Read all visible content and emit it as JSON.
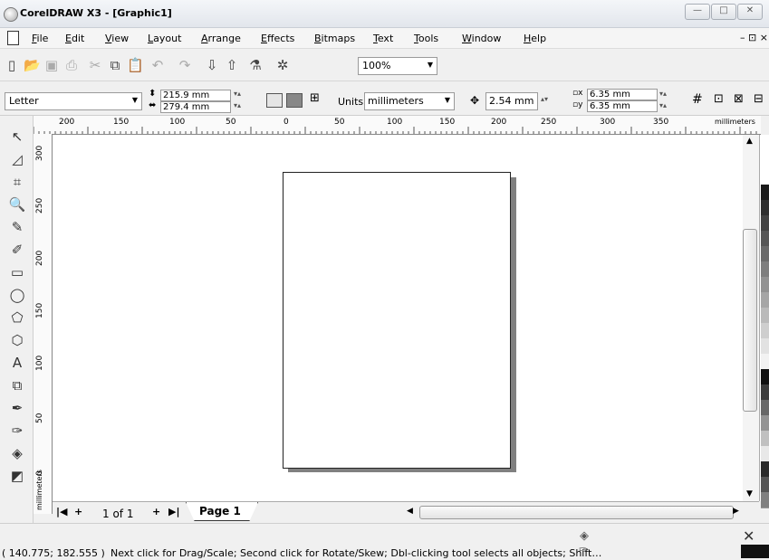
{
  "window": {
    "title": "CorelDRAW X3 - [Graphic1]",
    "min": "—",
    "max": "□",
    "close": "✕"
  },
  "menu": {
    "items": [
      "File",
      "Edit",
      "View",
      "Layout",
      "Arrange",
      "Effects",
      "Bitmaps",
      "Text",
      "Tools",
      "Window",
      "Help"
    ],
    "right_controls": "– ⊡ ×"
  },
  "standard_toolbar": {
    "zoom": "100%"
  },
  "property_bar": {
    "paper": "Letter",
    "width": "215.9 mm",
    "height": "279.4 mm",
    "units_label": "Units:",
    "units": "millimeters",
    "nudge": "2.54 mm",
    "dup_x": "6.35 mm",
    "dup_y": "6.35 mm"
  },
  "ruler": {
    "h_labels": [
      "200",
      "150",
      "100",
      "50",
      "0",
      "50",
      "100",
      "150",
      "200",
      "250",
      "300",
      "350"
    ],
    "h_units": "millimeters",
    "v_labels": [
      "300",
      "250",
      "200",
      "150",
      "100",
      "50",
      "0"
    ],
    "v_units": "millimeters"
  },
  "page_nav": {
    "count": "1 of 1",
    "tab": "Page 1"
  },
  "status": {
    "coords": "( 140.775; 182.555 )",
    "message": "Next click for Drag/Scale; Second click for Rotate/Skew; Dbl-clicking tool selects all objects; Shift…"
  },
  "palette": {
    "colors": [
      "#ffffff",
      "#1a1a1a",
      "#2e2e2e",
      "#424242",
      "#565656",
      "#6a6a6a",
      "#7e7e7e",
      "#929292",
      "#a6a6a6",
      "#bababa",
      "#cecece",
      "#e2e2e2",
      "#f2f2f2",
      "#111111",
      "#3c3c3c",
      "#686868",
      "#949494",
      "#c0c0c0",
      "#e8e8e8",
      "#2a2a2a",
      "#555555",
      "#808080"
    ]
  }
}
